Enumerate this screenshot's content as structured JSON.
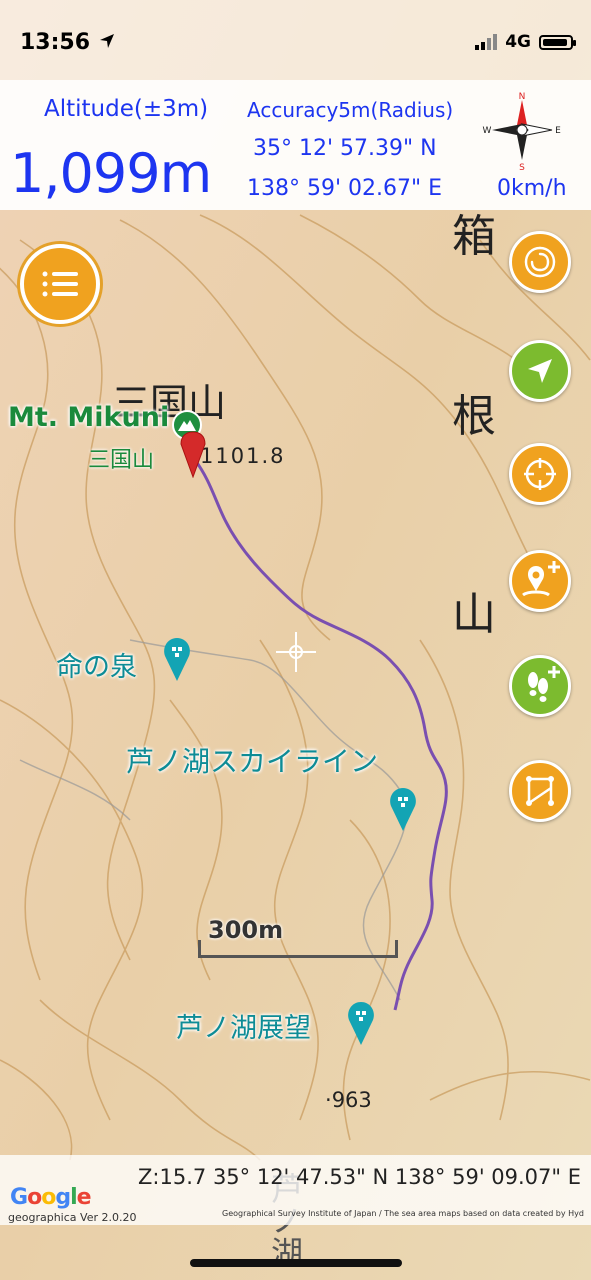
{
  "status_bar": {
    "time": "13:56",
    "network": "4G"
  },
  "info": {
    "altitude_label": "Altitude(±3m)",
    "altitude_value": "1,099m",
    "accuracy_label": "Accuracy5m(Radius)",
    "latitude": "35° 12' 57.39\" N",
    "longitude": "138° 59' 02.67\" E",
    "speed": "0km/h",
    "compass_letters": {
      "n": "N",
      "s": "S",
      "e": "E",
      "w": "W"
    }
  },
  "map": {
    "peak_name_en": "Mt. Mikuni",
    "peak_name_jp": "三国山",
    "peak_big_label": "三国山",
    "peak_elevation": "1101.8",
    "poi_spring": "命の泉",
    "poi_skyline": "芦ノ湖スカイライン",
    "poi_view": "芦ノ湖展望",
    "vertical_chars": [
      "箱",
      "根",
      "山"
    ],
    "elevation_point": "963",
    "scale_label": "300m",
    "bottom_vertical": "芦ノ湖"
  },
  "bottom": {
    "zoom_coords": "Z:15.7  35° 12' 47.53\" N 138° 59' 09.07\" E",
    "google": "Google",
    "version": "geographica Ver 2.0.20",
    "credit": "Geographical Survey Institute of Japan / The sea area maps based on data created by Hydrographi..."
  },
  "icons": {
    "menu": "list-icon",
    "rotate_map": "spiral-icon",
    "locate": "navigation-arrow-icon",
    "center": "crosshair-icon",
    "add_point": "add-pin-icon",
    "add_track": "add-footprints-icon",
    "route": "route-icon"
  },
  "colors": {
    "accent_blue": "#1d35f0",
    "button_orange": "#f0a21f",
    "button_green": "#7cbb2f",
    "poi_teal": "#0e8c96",
    "peak_green": "#1a8a3c",
    "track_purple": "#7a4fb0",
    "pin_red": "#d42a2a"
  }
}
